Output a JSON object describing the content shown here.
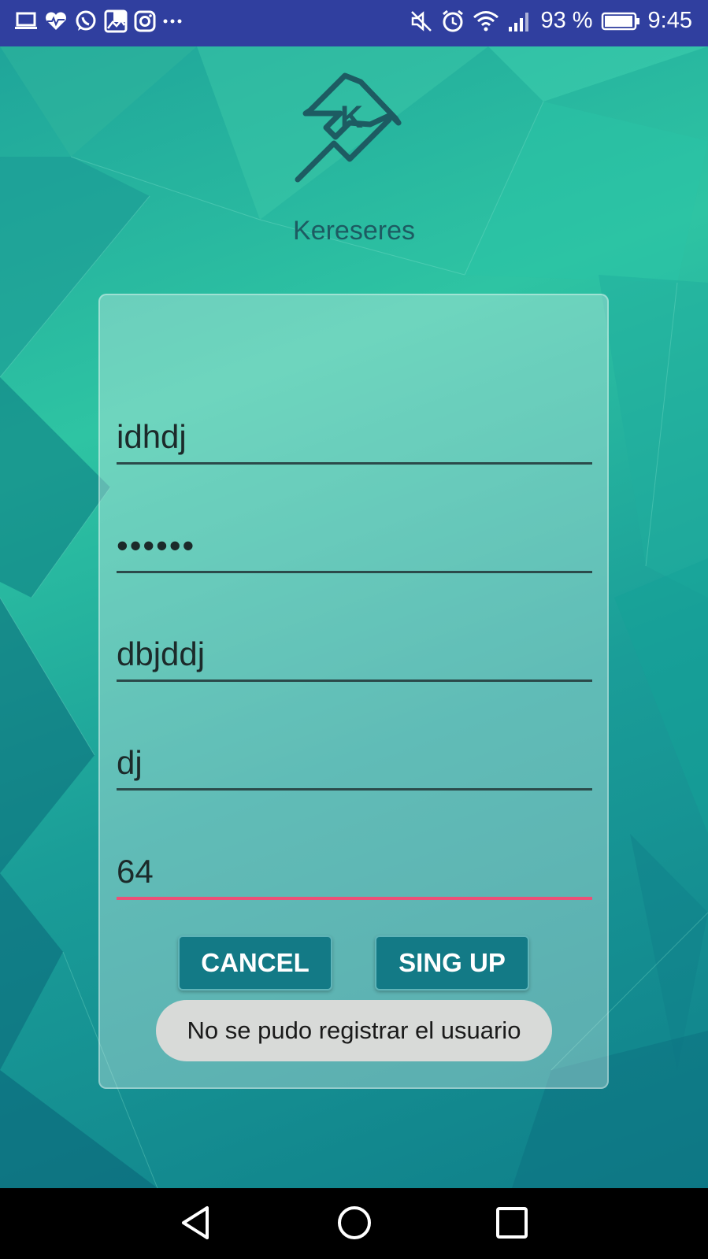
{
  "status_bar": {
    "battery_percent": "93 %",
    "time": "9:45",
    "left_icons": [
      "laptop-icon",
      "heart-pulse-icon",
      "whatsapp-icon",
      "gallery-icon",
      "instagram-icon",
      "more-icon"
    ],
    "right_icons": [
      "mute-icon",
      "alarm-icon",
      "wifi-icon",
      "signal-icon",
      "battery-icon"
    ]
  },
  "app": {
    "name": "Kereseres",
    "logo": "kereseres-logo"
  },
  "form": {
    "fields": [
      {
        "value": "idhdj"
      },
      {
        "value": "••••••"
      },
      {
        "value": "dbjddj"
      },
      {
        "value": "dj"
      },
      {
        "value": "64"
      }
    ],
    "cancel_label": "CANCEL",
    "signup_label": "SING UP"
  },
  "toast": {
    "message": "No se pudo registrar el usuario"
  },
  "colors": {
    "status_bar": "#303f9f",
    "button": "#137a86",
    "active_underline": "#ec5077"
  },
  "nav": {
    "icons": [
      "back-icon",
      "home-icon",
      "recents-icon"
    ]
  }
}
